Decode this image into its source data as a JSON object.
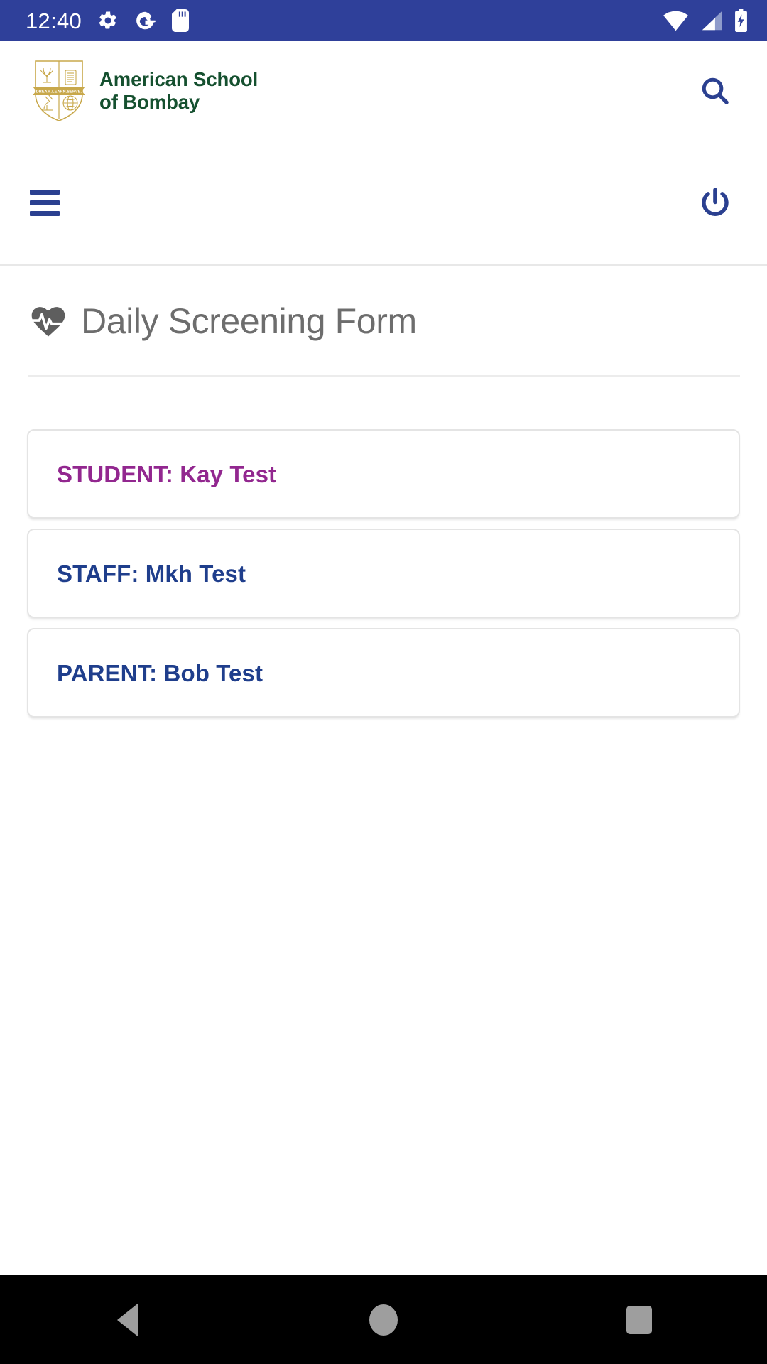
{
  "status_bar": {
    "time": "12:40",
    "background_color": "#2F409A",
    "left_icons": [
      "gear-icon",
      "google-icon",
      "sd-card-icon"
    ],
    "right_icons": [
      "wifi-icon",
      "cellular-signal-icon",
      "battery-charging-icon"
    ]
  },
  "header": {
    "logo_name": "school-crest-logo",
    "logo_motto": "DREAM.LEARN.SERVE.",
    "school_name": "American School\nof Bombay",
    "school_name_color": "#15502F",
    "search_icon": "search-icon"
  },
  "toolbar": {
    "menu_icon": "hamburger-menu-icon",
    "power_icon": "power-logout-icon",
    "icon_color": "#2B4090"
  },
  "page": {
    "title": "Daily Screening Form",
    "title_icon": "heart-pulse-icon",
    "title_color": "#6d6d6d"
  },
  "list": {
    "items": [
      {
        "label": "STUDENT: Kay Test",
        "color": "#92278F",
        "role": "student"
      },
      {
        "label": "STAFF: Mkh Test",
        "color": "#1F3E8C",
        "role": "staff"
      },
      {
        "label": "PARENT: Bob Test",
        "color": "#1F3E8C",
        "role": "parent"
      }
    ]
  },
  "nav_bar": {
    "back_label": "back-button",
    "home_label": "home-button",
    "recents_label": "recents-button",
    "background_color": "#000000",
    "icon_color": "#9e9e9e"
  }
}
